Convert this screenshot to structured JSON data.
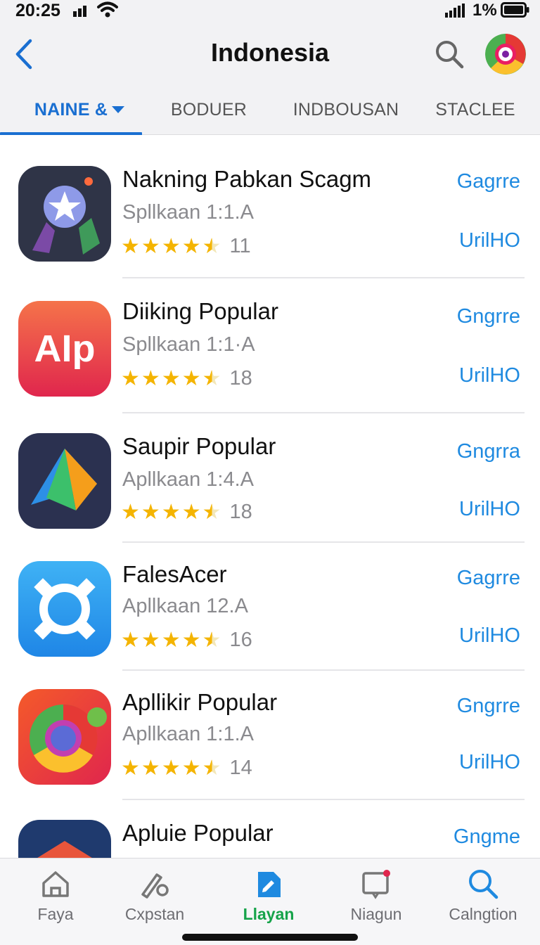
{
  "status": {
    "time": "20:25",
    "battery": "1%"
  },
  "nav": {
    "title": "Indonesia"
  },
  "tabs": [
    {
      "label": "NAINE &",
      "active": true
    },
    {
      "label": "BODUER",
      "active": false
    },
    {
      "label": "INDBOUSAN",
      "active": false
    },
    {
      "label": "STACLEE",
      "active": false
    }
  ],
  "apps": [
    {
      "name": "Nakning Pabkan Scagm",
      "sub": "Spllkaan 1:1.A",
      "rating": 4.5,
      "count": "11",
      "action1": "Gagrre",
      "action2": "UrilHO",
      "icon": "star-hands-icon"
    },
    {
      "name": "Diiking Popular",
      "sub": "Spllkaan 1:1·A",
      "rating": 4.5,
      "count": "18",
      "action1": "Gngrre",
      "action2": "UrilHO",
      "icon": "aip-icon"
    },
    {
      "name": "Saupir Popular",
      "sub": "Apllkaan 1:4.A",
      "rating": 4.5,
      "count": "18",
      "action1": "Gngrra",
      "action2": "UrilHO",
      "icon": "triangle-icon"
    },
    {
      "name": "FalesAcer",
      "sub": "Apllkaan 12.A",
      "rating": 4.5,
      "count": "16",
      "action1": "Gagrre",
      "action2": "UrilHO",
      "icon": "ring-icon"
    },
    {
      "name": "Apllikir Popular",
      "sub": "Apllkaan 1:1.A",
      "rating": 4.5,
      "count": "14",
      "action1": "Gngrre",
      "action2": "UrilHO",
      "icon": "chrome-icon"
    },
    {
      "name": "Apluie Popular",
      "sub": "",
      "rating": null,
      "count": "",
      "action1": "Gngme",
      "action2": "",
      "icon": "partial-app-icon"
    }
  ],
  "tabbar": [
    {
      "label": "Faya",
      "icon": "home-icon",
      "active": false
    },
    {
      "label": "Cxpstan",
      "icon": "tool-icon",
      "active": false
    },
    {
      "label": "Llayan",
      "icon": "apps-icon",
      "active": true
    },
    {
      "label": "Niagun",
      "icon": "notification-icon",
      "active": false
    },
    {
      "label": "Calngtion",
      "icon": "search-icon",
      "active": false
    }
  ],
  "colors": {
    "accent": "#1a6fd1",
    "link": "#1f8ae0",
    "star": "#f4b400",
    "active_tab": "#16a34a"
  }
}
